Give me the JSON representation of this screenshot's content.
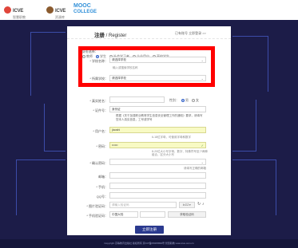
{
  "header": {
    "logo_icve": "ICVE",
    "logo_icve_sub": "智慧职教",
    "logo_icve2": "ICVE",
    "logo_icve2_sub": "资源库",
    "logo_mooc": "MOOC",
    "logo_college": "COLLEGE"
  },
  "form": {
    "title": "注册",
    "title_en": "/ Register",
    "login_link": "已有账号 立即登录 >>",
    "identity_label": "* 身份选择：",
    "identity_options": [
      "教师",
      "学生",
      "社会学习者",
      "企业用户",
      "高校学生"
    ],
    "school_label": "* 学校名称：",
    "school_value": "请选择学校",
    "school_placeholder": "输入或搜索学校名称",
    "school_type_label": "* 所属学校：",
    "school_type_value": "请选择学校",
    "realname_label": "* 真实姓名：",
    "gender_label": "性别：",
    "gender_options": [
      "男",
      "女"
    ],
    "id_label": "* 证件号：",
    "id_type": "身份证",
    "notice_text": "根据《关于加强职业教育学生信息安全管理工作的通知》要求，请填写您本人真实信息，工号或学号",
    "account_label": "* 用户名：",
    "account_value": "jiaoshi",
    "account_hint": "6-18位字母，可使用字母和数字",
    "password_label": "* 密码：",
    "password_value": "••••••",
    "password_hint": "8-20位大小写字母、数字、特殊符号至少两种组合，区分大小写",
    "strength_label": "* 确认密码：",
    "email_label": "邮箱：",
    "email_hint": "请填写正确的邮箱",
    "phone_label": "* 手机：",
    "qq_label": "QQ号：",
    "captcha_label": "* 图片验证码：",
    "captcha_placeholder": "请输入验证码",
    "captcha_code": "kG2e",
    "sms_label": "* 手机验证码：",
    "sms_country": "中国大陆",
    "sms_value": "",
    "sms_button": "获取验证码",
    "submit_label": "立即注册"
  },
  "footer": {
    "copyright": "Copyright 高等教育出版社 版权所有 京ICP备05005899号 智慧职教 www.icve.com.cn"
  },
  "colors": {
    "background": "#1c1c48",
    "accent": "#2b3a8f",
    "highlight_box": "#ff0000",
    "filled_field": "#f8fac4"
  }
}
